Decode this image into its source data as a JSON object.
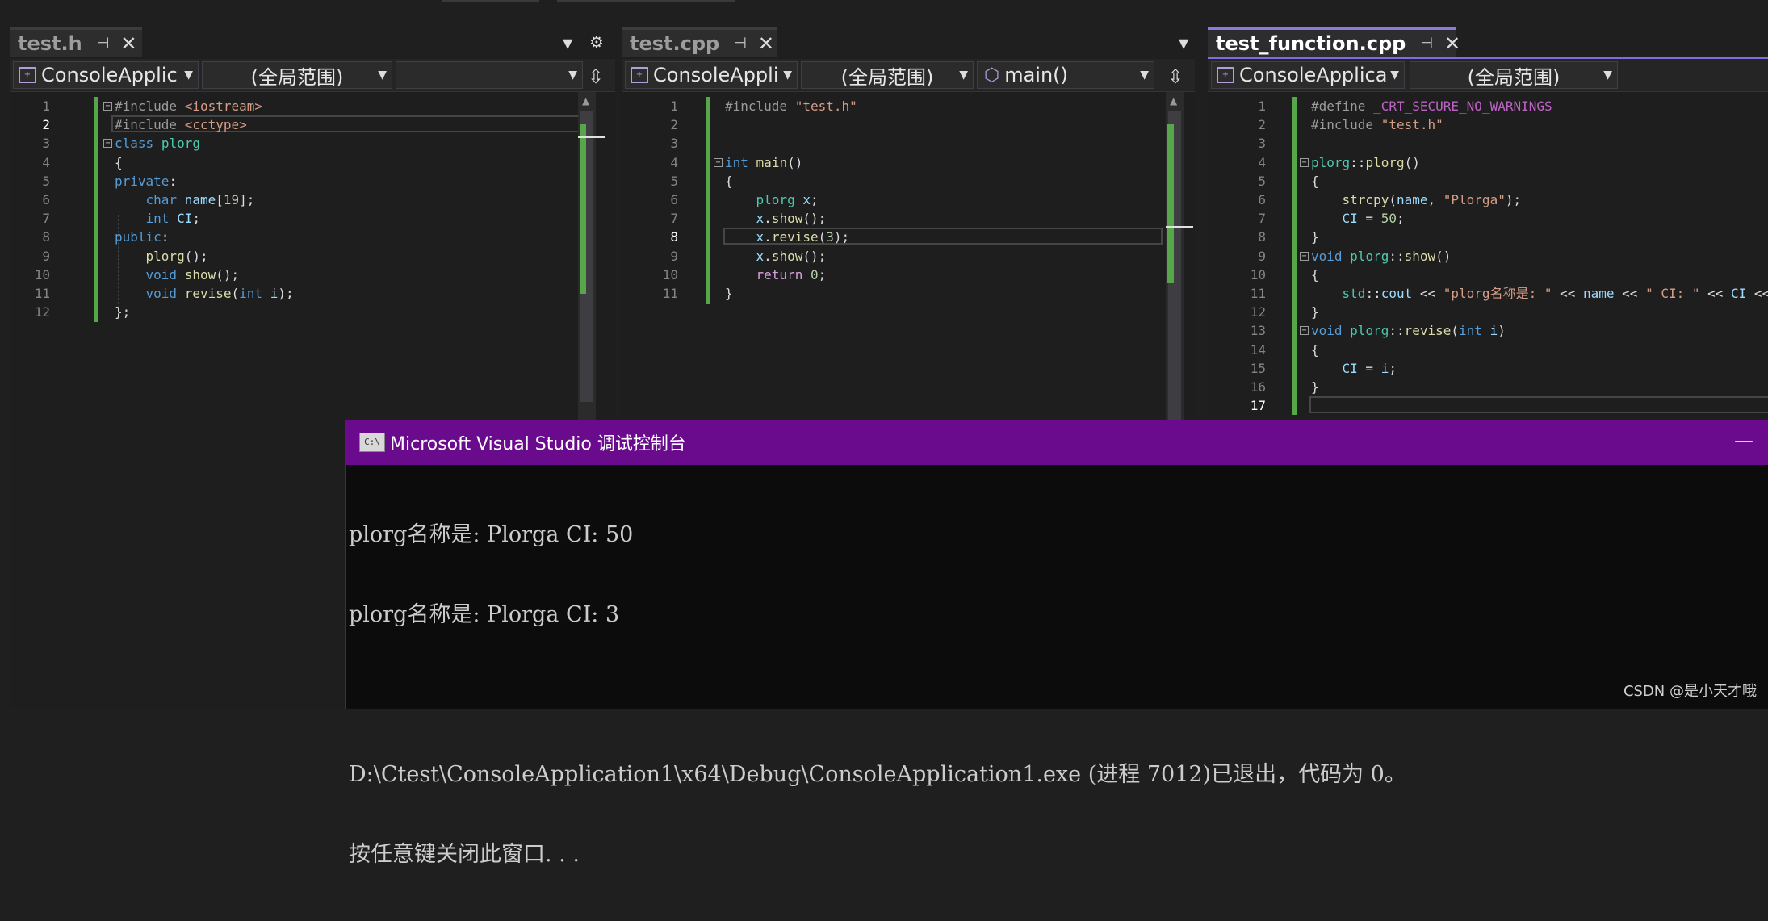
{
  "panes": [
    {
      "tab": {
        "label": "test.h",
        "active": false
      },
      "nav": {
        "project": "ConsoleApplic",
        "scope": "(全局范围)",
        "member": ""
      },
      "current_line": 2,
      "lines": [
        "#include <iostream>",
        "#include <cctype>",
        "class plorg",
        "{",
        "private:",
        "    char name[19];",
        "    int CI;",
        "public:",
        "    plorg();",
        "    void show();",
        "    void revise(int i);",
        "};"
      ]
    },
    {
      "tab": {
        "label": "test.cpp",
        "active": false
      },
      "nav": {
        "project": "ConsoleAppli",
        "scope": "(全局范围)",
        "member": "main()"
      },
      "current_line": 8,
      "lines": [
        "#include \"test.h\"",
        "",
        "",
        "int main()",
        "{",
        "    plorg x;",
        "    x.show();",
        "    x.revise(3);",
        "    x.show();",
        "    return 0;",
        "}"
      ]
    },
    {
      "tab": {
        "label": "test_function.cpp",
        "active": true
      },
      "nav": {
        "project": "ConsoleApplica",
        "scope": "(全局范围)",
        "member": ""
      },
      "current_line": 17,
      "lines": [
        "#define _CRT_SECURE_NO_WARNINGS",
        "#include \"test.h\"",
        "",
        "plorg::plorg()",
        "{",
        "    strcpy(name, \"Plorga\");",
        "    CI = 50;",
        "}",
        "void plorg::show()",
        "{",
        "    std::cout << \"plorg名称是: \" << name << \" CI: \" << CI <<",
        "}",
        "void plorg::revise(int i)",
        "{",
        "    CI = i;",
        "}",
        ""
      ]
    }
  ],
  "icons": {
    "pin": "pin-icon",
    "close": "close-icon",
    "dropdown": "chevron-down-icon",
    "settings": "gear-icon",
    "split": "split-editor-icon",
    "project": "project-icon",
    "member": "cube-icon"
  },
  "console": {
    "title": "Microsoft Visual Studio 调试控制台",
    "icon_text": "C:\\",
    "minimize": "—",
    "output": [
      "plorg名称是: Plorga CI: 50",
      "plorg名称是: Plorga CI: 3",
      "",
      "D:\\Ctest\\ConsoleApplication1\\x64\\Debug\\ConsoleApplication1.exe (进程 7012)已退出，代码为 0。",
      "按任意键关闭此窗口. . ."
    ]
  },
  "watermark": "CSDN @是小天才哦",
  "colors": {
    "accent": "#7c6ee0",
    "console_title": "#6a0a8c",
    "change_bar": "#57a64a"
  }
}
